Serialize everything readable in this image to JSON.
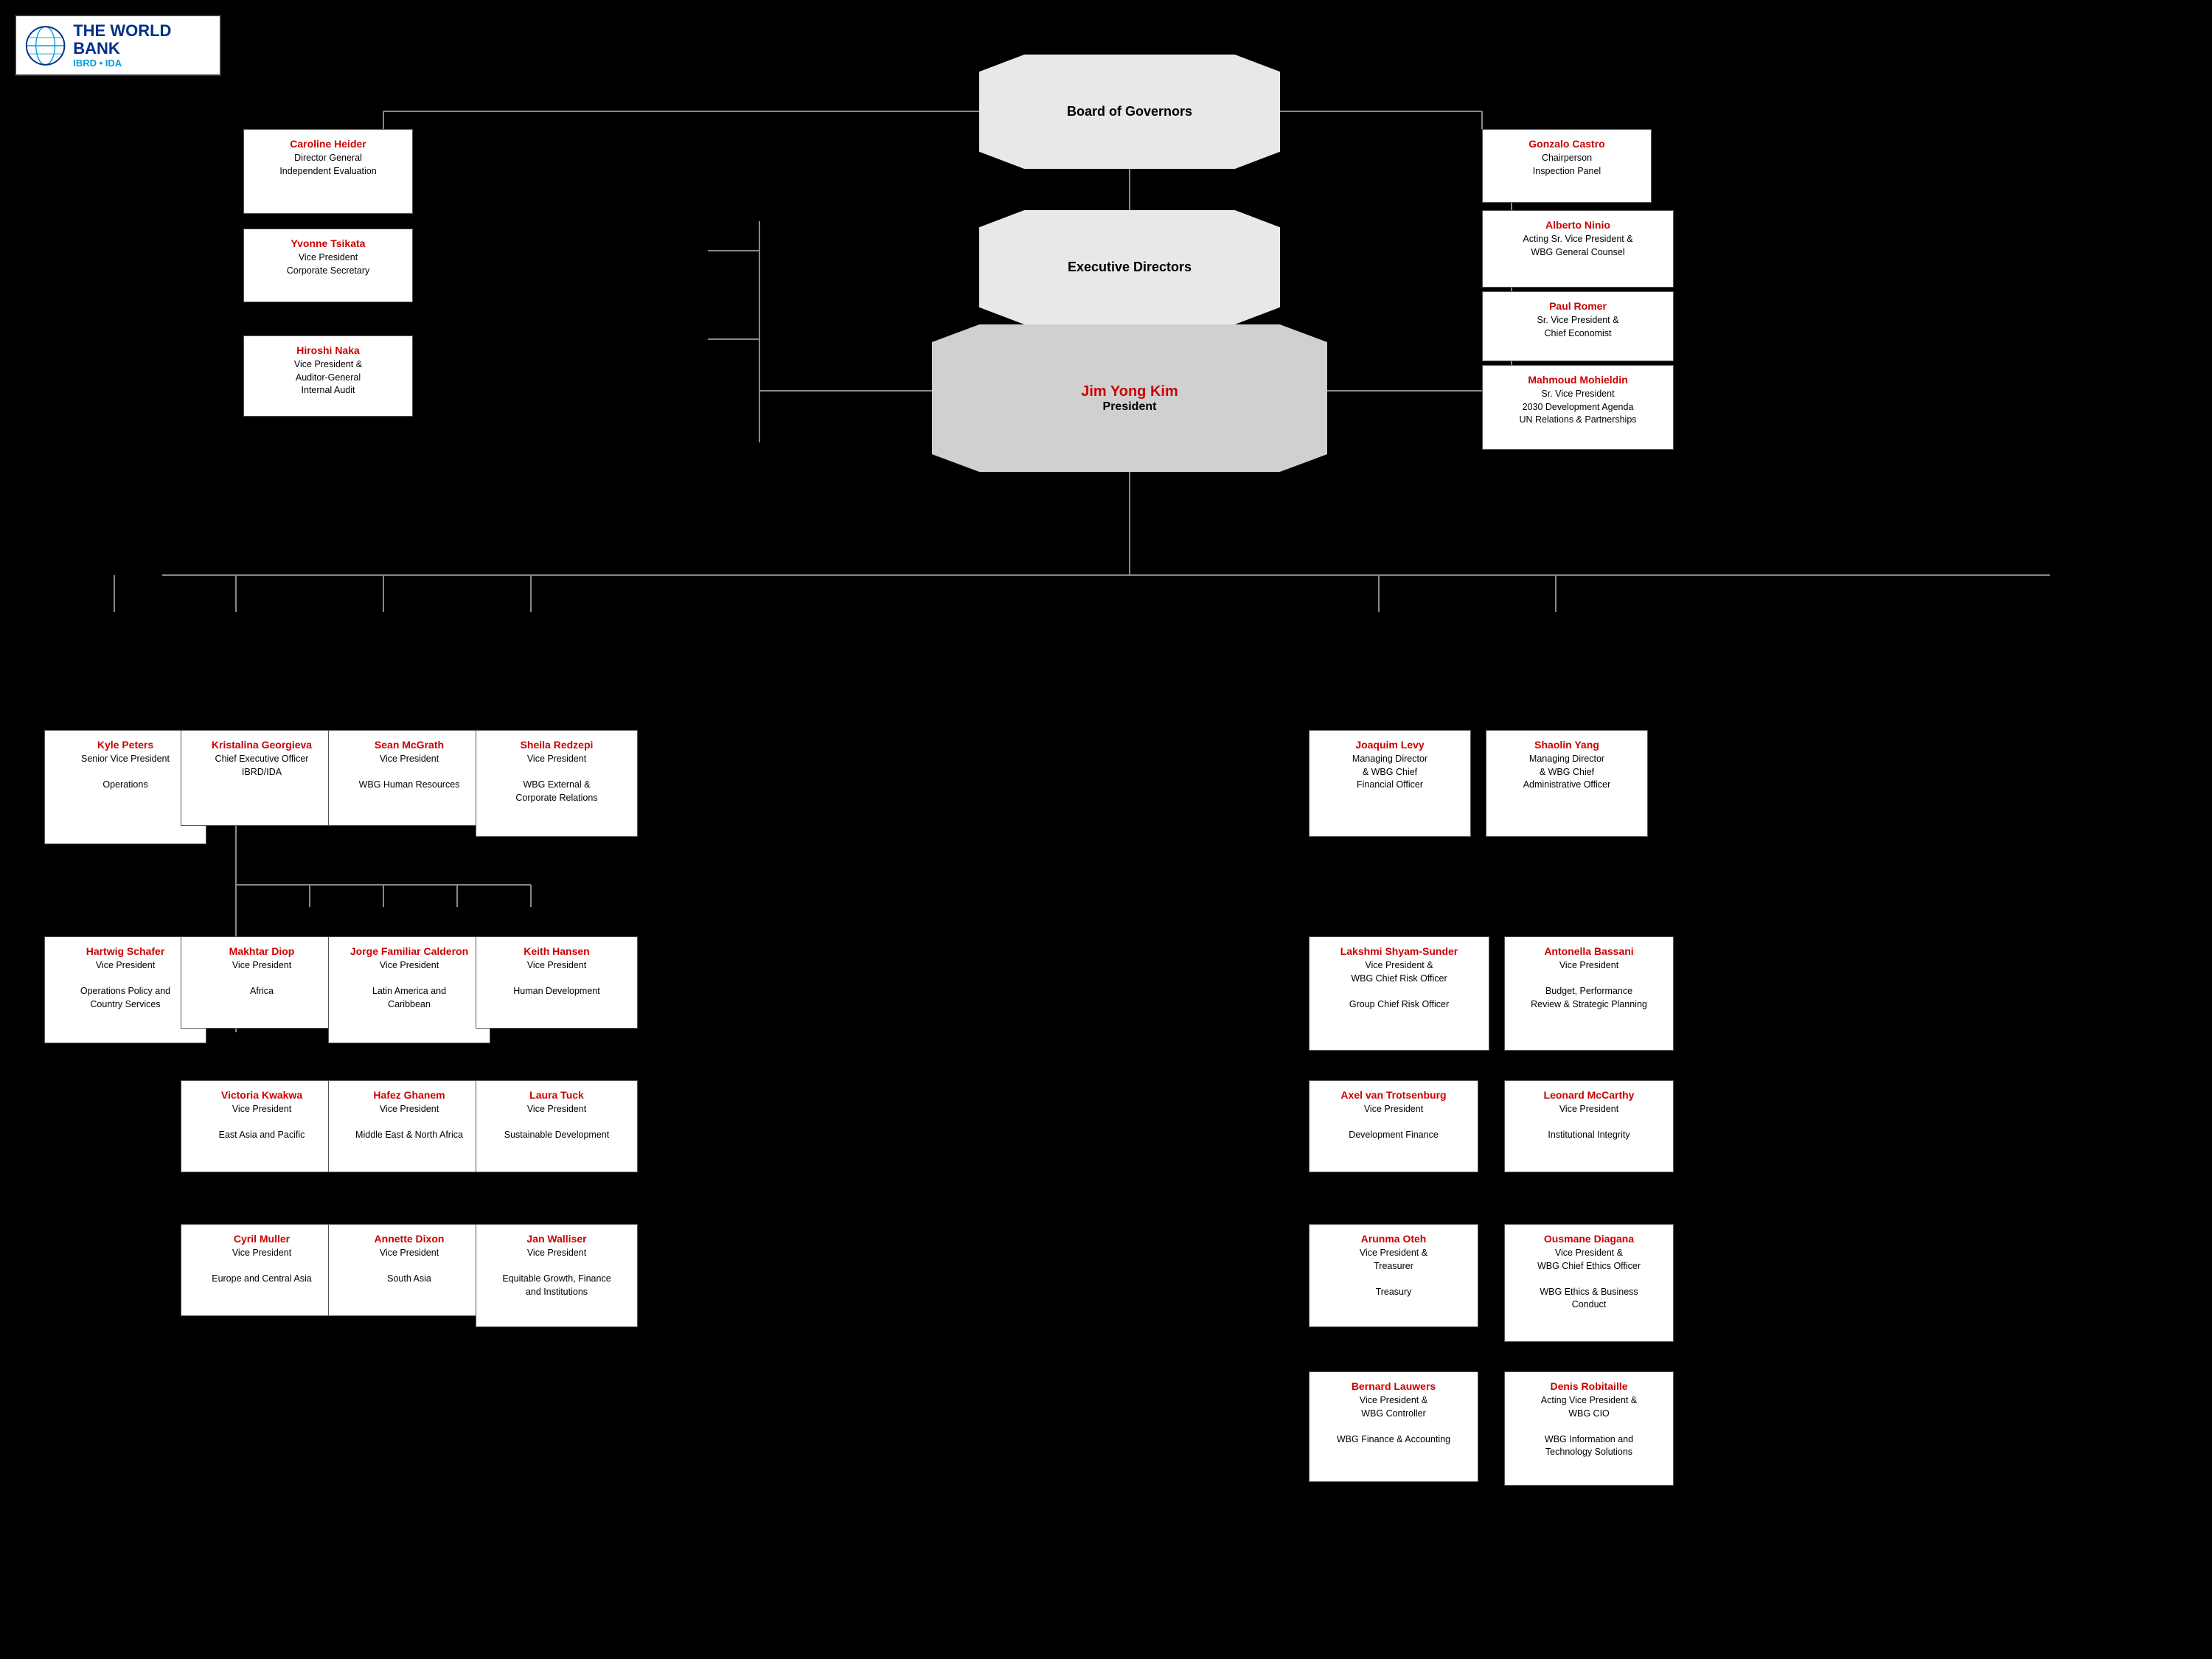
{
  "logo": {
    "title": "THE WORLD BANK",
    "subtitle": "IBRD • IDA"
  },
  "board_of_governors": "Board of Governors",
  "executive_directors": "Executive Directors",
  "president": {
    "name": "Jim Yong Kim",
    "title": "President"
  },
  "top_right_cards": [
    {
      "name": "Gonzalo Castro",
      "title": "Chairperson\nInspection Panel"
    },
    {
      "name": "Alberto Ninio",
      "title": "Acting Sr. Vice President &\nWBG General Counsel"
    },
    {
      "name": "Paul Romer",
      "title": "Sr. Vice President &\nChief Economist"
    },
    {
      "name": "Mahmoud Mohieldin",
      "title": "Sr. Vice President\n2030 Development Agenda\nUN Relations & Partnerships"
    }
  ],
  "top_left_cards": [
    {
      "name": "Caroline Heider",
      "title": "Director General\nIndependent Evaluation"
    },
    {
      "name": "Yvonne Tsikata",
      "title": "Vice President\nCorporate Secretary"
    },
    {
      "name": "Hiroshi Naka",
      "title": "Vice President &\nAuditor-General\nInternal Audit"
    }
  ],
  "row1_cards": [
    {
      "name": "Kyle Peters",
      "title": "Senior Vice President\n\nOperations"
    },
    {
      "name": "Kristalina Georgieva",
      "title": "Chief Executive Officer\nIBRD/IDA"
    },
    {
      "name": "Sean McGrath",
      "title": "Vice President\n\nWBG Human Resources"
    },
    {
      "name": "Sheila Redzepi",
      "title": "Vice President\n\nWBG External &\nCorporate Relations"
    },
    {
      "name": "Joaquim Levy",
      "title": "Managing Director\n& WBG Chief\nFinancial Officer"
    },
    {
      "name": "Shaolin Yang",
      "title": "Managing Director\n& WBG Chief\nAdministrative Officer"
    }
  ],
  "row2_left_cards": [
    {
      "name": "Hartwig Schafer",
      "title": "Vice President\n\nOperations Policy and\nCountry Services"
    },
    {
      "name": "Makhtar Diop",
      "title": "Vice President\n\nAfrica"
    },
    {
      "name": "Jorge Familiar Calderon",
      "title": "Vice President\n\nLatin America and\nCaribbean"
    },
    {
      "name": "Keith Hansen",
      "title": "Vice President\n\nHuman Development"
    }
  ],
  "row2_right_cards": [
    {
      "name": "Lakshmi Shyam-Sunder",
      "title": "Vice President &\nWBG Chief Risk Officer\n\nGroup Chief Risk Officer"
    },
    {
      "name": "Antonella Bassani",
      "title": "Vice President\n\nBudget, Performance\nReview & Strategic Planning"
    }
  ],
  "row3_left_cards": [
    {
      "name": "Victoria Kwakwa",
      "title": "Vice President\n\nEast Asia and Pacific"
    },
    {
      "name": "Hafez Ghanem",
      "title": "Vice President\n\nMiddle East & North Africa"
    },
    {
      "name": "Laura Tuck",
      "title": "Vice President\n\nSustainable Development"
    }
  ],
  "row3_right_cards": [
    {
      "name": "Axel van Trotsenburg",
      "title": "Vice President\n\nDevelopment Finance"
    },
    {
      "name": "Leonard McCarthy",
      "title": "Vice President\n\nInstitutional Integrity"
    }
  ],
  "row4_left_cards": [
    {
      "name": "Cyril Muller",
      "title": "Vice President\n\nEurope and Central Asia"
    },
    {
      "name": "Annette Dixon",
      "title": "Vice President\n\nSouth Asia"
    },
    {
      "name": "Jan Walliser",
      "title": "Vice President\n\nEquitable Growth, Finance\nand Institutions"
    }
  ],
  "row4_right_cards": [
    {
      "name": "Arunma Oteh",
      "title": "Vice President &\nTreasurer\n\nTreasury"
    },
    {
      "name": "Ousmane Diagana",
      "title": "Vice President  &\nWBG Chief Ethics Officer\n\nWBG Ethics & Business\nConduct"
    }
  ],
  "row5_right_cards": [
    {
      "name": "Bernard Lauwers",
      "title": "Vice President &\nWBG Controller\n\nWBG Finance & Accounting"
    },
    {
      "name": "Denis Robitaille",
      "title": "Acting Vice President &\nWBG CIO\n\nWBG Information and\nTechnology Solutions"
    }
  ]
}
